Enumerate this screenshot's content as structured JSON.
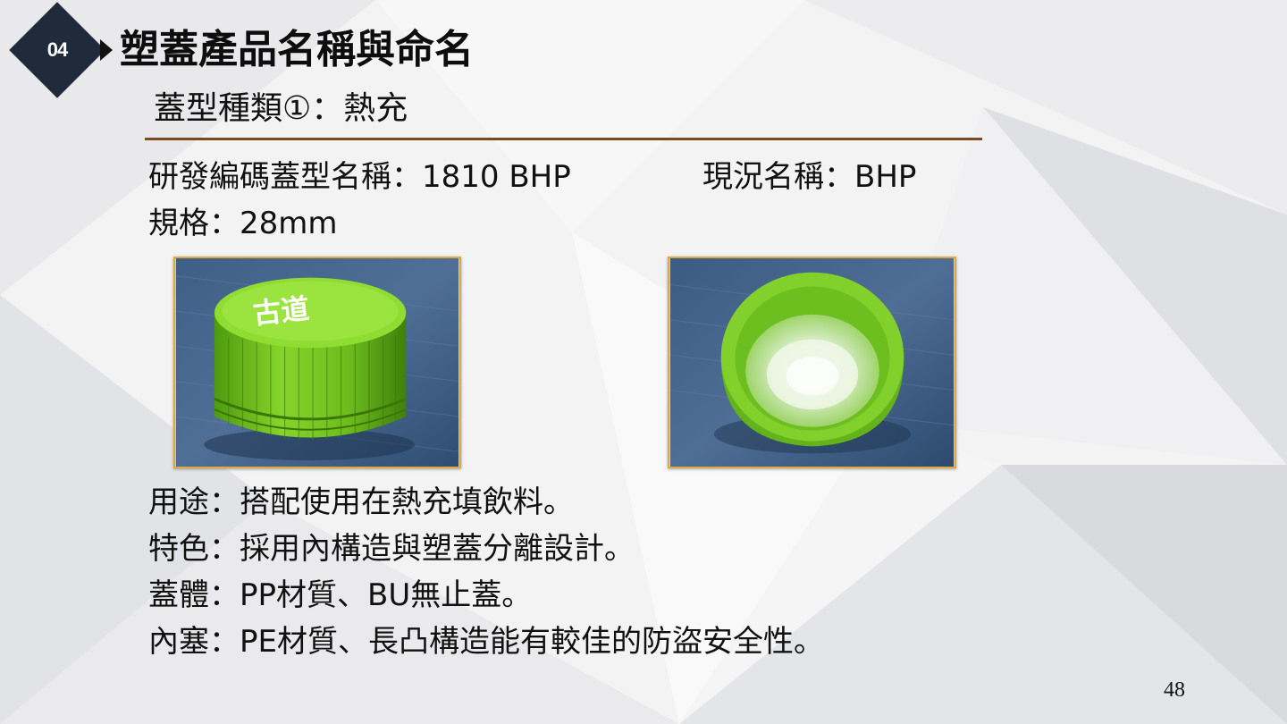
{
  "slide": {
    "section_number": "04",
    "title": "塑蓋產品名稱與命名",
    "subtitle": "蓋型種類①：熱充",
    "page_number": "48"
  },
  "info": {
    "dev_code": "研發編碼蓋型名稱：1810 BHP",
    "current_name": "現況名稱：BHP",
    "spec": "規格：28mm"
  },
  "images": {
    "left_cap_text": "古道"
  },
  "details": [
    "用途：搭配使用在熱充填飲料。",
    "特色：採用內構造與塑蓋分離設計。",
    "蓋體：PP材質、BU無止蓋。",
    "內塞：PE材質、長凸構造能有較佳的防盜安全性。"
  ],
  "colors": {
    "badge": "#1f2a3a",
    "rule": "#7a4a1c",
    "photo_border": "#e0a93a",
    "cap_green": "#7ed321"
  }
}
